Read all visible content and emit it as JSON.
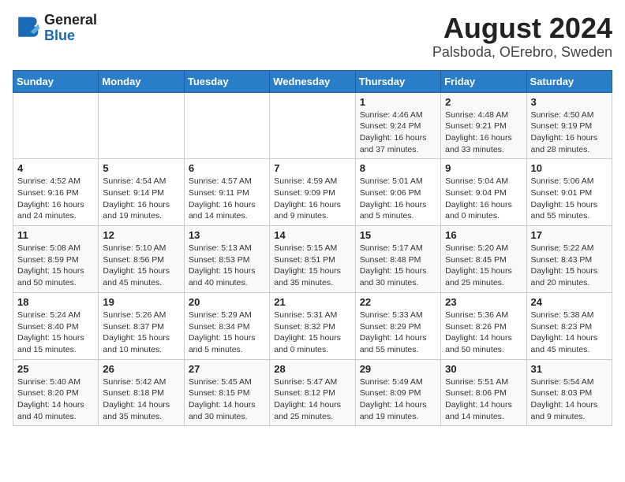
{
  "header": {
    "logo_line1": "General",
    "logo_line2": "Blue",
    "title": "August 2024",
    "subtitle": "Palsboda, OErebro, Sweden"
  },
  "days_of_week": [
    "Sunday",
    "Monday",
    "Tuesday",
    "Wednesday",
    "Thursday",
    "Friday",
    "Saturday"
  ],
  "weeks": [
    [
      {
        "day": "",
        "detail": ""
      },
      {
        "day": "",
        "detail": ""
      },
      {
        "day": "",
        "detail": ""
      },
      {
        "day": "",
        "detail": ""
      },
      {
        "day": "1",
        "detail": "Sunrise: 4:46 AM\nSunset: 9:24 PM\nDaylight: 16 hours\nand 37 minutes."
      },
      {
        "day": "2",
        "detail": "Sunrise: 4:48 AM\nSunset: 9:21 PM\nDaylight: 16 hours\nand 33 minutes."
      },
      {
        "day": "3",
        "detail": "Sunrise: 4:50 AM\nSunset: 9:19 PM\nDaylight: 16 hours\nand 28 minutes."
      }
    ],
    [
      {
        "day": "4",
        "detail": "Sunrise: 4:52 AM\nSunset: 9:16 PM\nDaylight: 16 hours\nand 24 minutes."
      },
      {
        "day": "5",
        "detail": "Sunrise: 4:54 AM\nSunset: 9:14 PM\nDaylight: 16 hours\nand 19 minutes."
      },
      {
        "day": "6",
        "detail": "Sunrise: 4:57 AM\nSunset: 9:11 PM\nDaylight: 16 hours\nand 14 minutes."
      },
      {
        "day": "7",
        "detail": "Sunrise: 4:59 AM\nSunset: 9:09 PM\nDaylight: 16 hours\nand 9 minutes."
      },
      {
        "day": "8",
        "detail": "Sunrise: 5:01 AM\nSunset: 9:06 PM\nDaylight: 16 hours\nand 5 minutes."
      },
      {
        "day": "9",
        "detail": "Sunrise: 5:04 AM\nSunset: 9:04 PM\nDaylight: 16 hours\nand 0 minutes."
      },
      {
        "day": "10",
        "detail": "Sunrise: 5:06 AM\nSunset: 9:01 PM\nDaylight: 15 hours\nand 55 minutes."
      }
    ],
    [
      {
        "day": "11",
        "detail": "Sunrise: 5:08 AM\nSunset: 8:59 PM\nDaylight: 15 hours\nand 50 minutes."
      },
      {
        "day": "12",
        "detail": "Sunrise: 5:10 AM\nSunset: 8:56 PM\nDaylight: 15 hours\nand 45 minutes."
      },
      {
        "day": "13",
        "detail": "Sunrise: 5:13 AM\nSunset: 8:53 PM\nDaylight: 15 hours\nand 40 minutes."
      },
      {
        "day": "14",
        "detail": "Sunrise: 5:15 AM\nSunset: 8:51 PM\nDaylight: 15 hours\nand 35 minutes."
      },
      {
        "day": "15",
        "detail": "Sunrise: 5:17 AM\nSunset: 8:48 PM\nDaylight: 15 hours\nand 30 minutes."
      },
      {
        "day": "16",
        "detail": "Sunrise: 5:20 AM\nSunset: 8:45 PM\nDaylight: 15 hours\nand 25 minutes."
      },
      {
        "day": "17",
        "detail": "Sunrise: 5:22 AM\nSunset: 8:43 PM\nDaylight: 15 hours\nand 20 minutes."
      }
    ],
    [
      {
        "day": "18",
        "detail": "Sunrise: 5:24 AM\nSunset: 8:40 PM\nDaylight: 15 hours\nand 15 minutes."
      },
      {
        "day": "19",
        "detail": "Sunrise: 5:26 AM\nSunset: 8:37 PM\nDaylight: 15 hours\nand 10 minutes."
      },
      {
        "day": "20",
        "detail": "Sunrise: 5:29 AM\nSunset: 8:34 PM\nDaylight: 15 hours\nand 5 minutes."
      },
      {
        "day": "21",
        "detail": "Sunrise: 5:31 AM\nSunset: 8:32 PM\nDaylight: 15 hours\nand 0 minutes."
      },
      {
        "day": "22",
        "detail": "Sunrise: 5:33 AM\nSunset: 8:29 PM\nDaylight: 14 hours\nand 55 minutes."
      },
      {
        "day": "23",
        "detail": "Sunrise: 5:36 AM\nSunset: 8:26 PM\nDaylight: 14 hours\nand 50 minutes."
      },
      {
        "day": "24",
        "detail": "Sunrise: 5:38 AM\nSunset: 8:23 PM\nDaylight: 14 hours\nand 45 minutes."
      }
    ],
    [
      {
        "day": "25",
        "detail": "Sunrise: 5:40 AM\nSunset: 8:20 PM\nDaylight: 14 hours\nand 40 minutes."
      },
      {
        "day": "26",
        "detail": "Sunrise: 5:42 AM\nSunset: 8:18 PM\nDaylight: 14 hours\nand 35 minutes."
      },
      {
        "day": "27",
        "detail": "Sunrise: 5:45 AM\nSunset: 8:15 PM\nDaylight: 14 hours\nand 30 minutes."
      },
      {
        "day": "28",
        "detail": "Sunrise: 5:47 AM\nSunset: 8:12 PM\nDaylight: 14 hours\nand 25 minutes."
      },
      {
        "day": "29",
        "detail": "Sunrise: 5:49 AM\nSunset: 8:09 PM\nDaylight: 14 hours\nand 19 minutes."
      },
      {
        "day": "30",
        "detail": "Sunrise: 5:51 AM\nSunset: 8:06 PM\nDaylight: 14 hours\nand 14 minutes."
      },
      {
        "day": "31",
        "detail": "Sunrise: 5:54 AM\nSunset: 8:03 PM\nDaylight: 14 hours\nand 9 minutes."
      }
    ]
  ]
}
